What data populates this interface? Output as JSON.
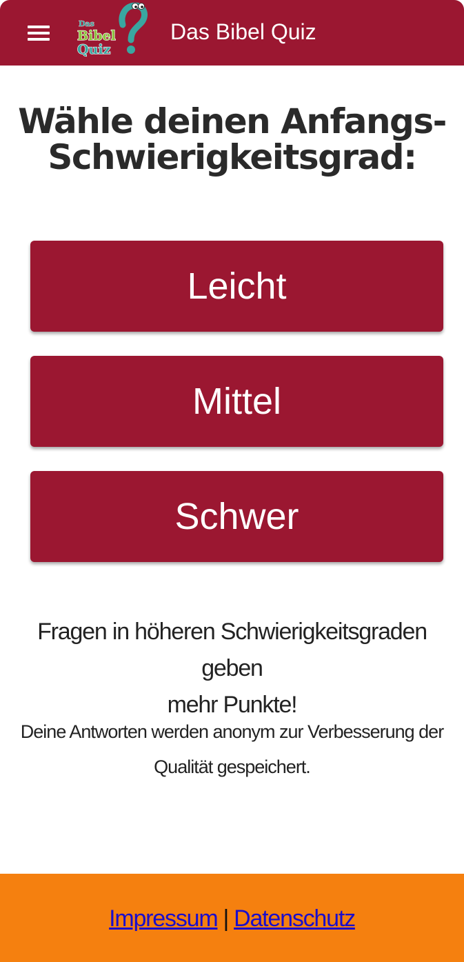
{
  "header": {
    "menu_icon": "hamburger-menu-icon",
    "logo": {
      "line1": "Das",
      "line2": "Bibel",
      "line3": "Quiz",
      "mark": "?"
    },
    "title": "Das Bibel Quiz"
  },
  "main": {
    "heading_line1": "Wähle deinen Anfangs-",
    "heading_line2": "Schwierigkeitsgrad:",
    "levels": [
      {
        "label": "Leicht"
      },
      {
        "label": "Mittel"
      },
      {
        "label": "Schwer"
      }
    ],
    "info_line1": "Fragen in höheren Schwierigkeitsgraden geben",
    "info_line2": "mehr Punkte!",
    "note_line1": "Deine Antworten werden anonym zur Verbesserung der",
    "note_line2": "Qualität gespeichert."
  },
  "footer": {
    "impressum": "Impressum",
    "separator": "|",
    "privacy": "Datenschutz"
  },
  "colors": {
    "brand": "#9b1731",
    "footer": "#f5800f",
    "link": "#1a0dcc",
    "logo_teal": "#3aa6a0",
    "logo_green": "#8dc13f"
  }
}
